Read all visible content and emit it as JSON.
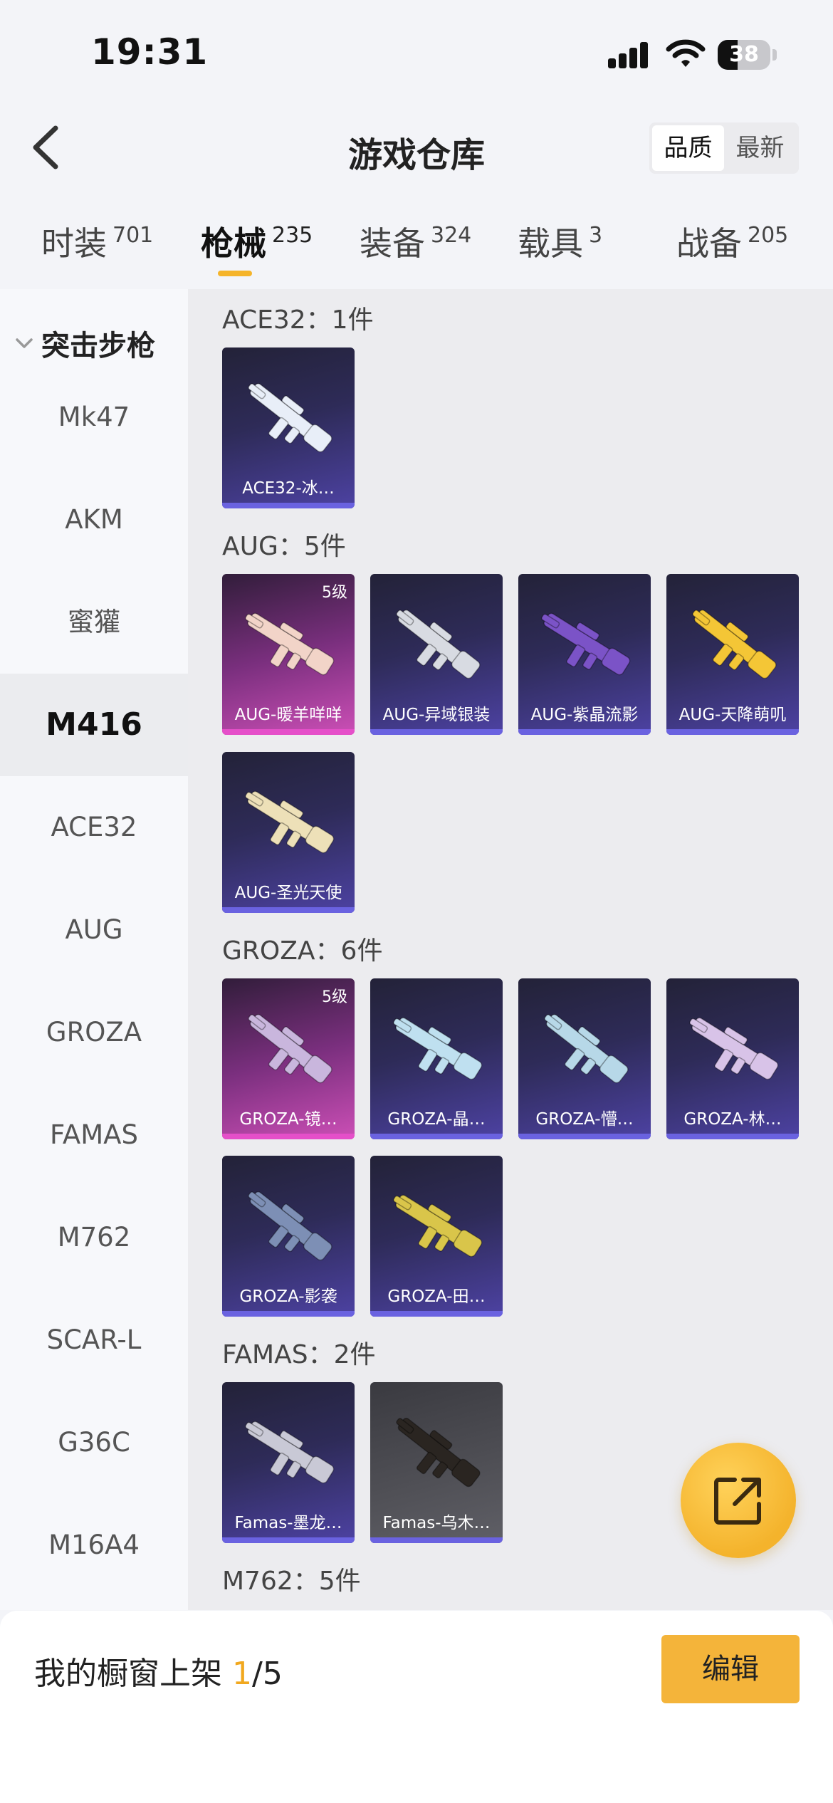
{
  "status_bar": {
    "time": "19:31",
    "battery": "38",
    "battery_level": 0.38
  },
  "header": {
    "title": "游戏仓库",
    "sort_options": [
      "品质",
      "最新"
    ]
  },
  "tabs": [
    {
      "label": "时装",
      "count": "701"
    },
    {
      "label": "枪械",
      "count": "235"
    },
    {
      "label": "装备",
      "count": "324"
    },
    {
      "label": "载具",
      "count": "3"
    },
    {
      "label": "战备",
      "count": "205"
    }
  ],
  "sidebar": {
    "group": "突击步枪",
    "items": [
      "Mk47",
      "AKM",
      "蜜獾",
      "M416",
      "ACE32",
      "AUG",
      "GROZA",
      "FAMAS",
      "M762",
      "SCAR-L",
      "G36C",
      "M16A4"
    ]
  },
  "sections": [
    {
      "title": "ACE32：1件",
      "items": [
        {
          "name": "ACE32-冰…",
          "color": "#e8eef8"
        }
      ]
    },
    {
      "title": "AUG：5件",
      "items": [
        {
          "name": "AUG-暖羊咩咩",
          "level": "5级",
          "color": "#f2d4c8"
        },
        {
          "name": "AUG-异域银装",
          "color": "#d8dbe2"
        },
        {
          "name": "AUG-紫晶流影",
          "color": "#7b53c7"
        },
        {
          "name": "AUG-天降萌叽",
          "color": "#f4c636"
        },
        {
          "name": "AUG-圣光天使",
          "color": "#ede0b8"
        }
      ]
    },
    {
      "title": "GROZA：6件",
      "items": [
        {
          "name": "GROZA-镜…",
          "level": "5级",
          "color": "#c9b6dd"
        },
        {
          "name": "GROZA-晶…",
          "color": "#bfe0f0"
        },
        {
          "name": "GROZA-懵…",
          "color": "#b7d8e8"
        },
        {
          "name": "GROZA-林…",
          "color": "#d8c3e8"
        },
        {
          "name": "GROZA-影袭",
          "color": "#7d8fb5"
        },
        {
          "name": "GROZA-田…",
          "color": "#d9c54a"
        }
      ]
    },
    {
      "title": "FAMAS：2件",
      "items": [
        {
          "name": "Famas-墨龙…",
          "color": "#c9c9d6"
        },
        {
          "name": "Famas-乌木…",
          "color": "#2a2521"
        }
      ]
    },
    {
      "title": "M762：5件",
      "items": []
    }
  ],
  "bottom_bar": {
    "label": "我的橱窗上架 ",
    "current": "1",
    "total": "/5",
    "edit_label": "编辑"
  }
}
